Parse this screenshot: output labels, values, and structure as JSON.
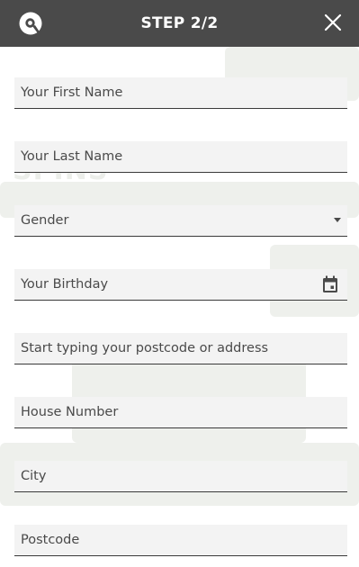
{
  "header": {
    "title": "STEP 2/2",
    "logo_icon": "brand-q-logo-icon",
    "close_icon": "close-icon",
    "background": "#4a4a4a"
  },
  "form": {
    "fields": [
      {
        "name": "first-name-input",
        "label": "Your First Name"
      },
      {
        "name": "last-name-input",
        "label": "Your Last Name"
      },
      {
        "name": "gender-select",
        "label": "Gender"
      },
      {
        "name": "birthday-input",
        "label": "Your Birthday"
      },
      {
        "name": "address-search-input",
        "label": "Start typing your postcode or address"
      },
      {
        "name": "house-number-input",
        "label": "House Number"
      },
      {
        "name": "city-input",
        "label": "City"
      },
      {
        "name": "postcode-input",
        "label": "Postcode"
      }
    ]
  },
  "background_text": "SPINS"
}
